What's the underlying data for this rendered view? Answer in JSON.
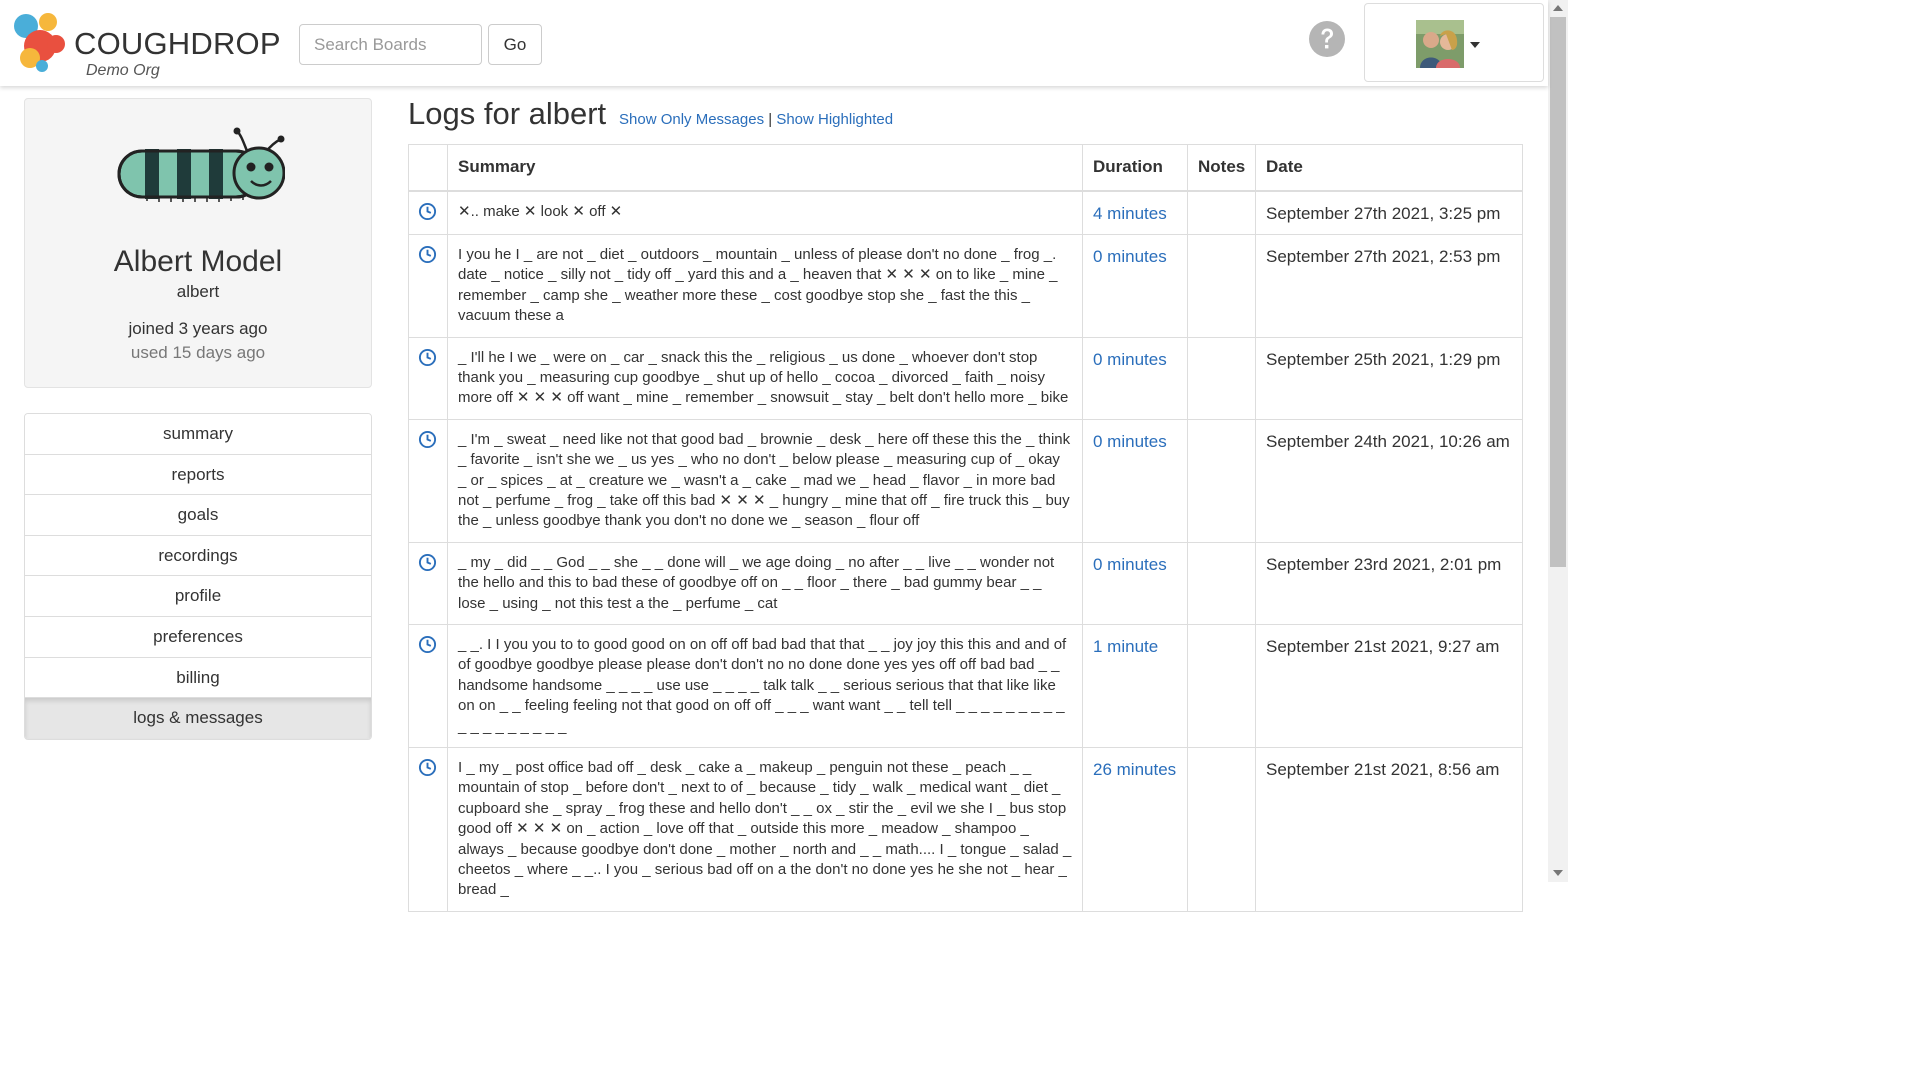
{
  "header": {
    "brand": "COUGHDROP",
    "org": "Demo Org",
    "search_placeholder": "Search Boards",
    "go_label": "Go"
  },
  "profile": {
    "name": "Albert Model",
    "username": "albert",
    "joined": "joined 3 years ago",
    "used": "used 15 days ago"
  },
  "nav": [
    {
      "label": "summary",
      "active": false
    },
    {
      "label": "reports",
      "active": false
    },
    {
      "label": "goals",
      "active": false
    },
    {
      "label": "recordings",
      "active": false
    },
    {
      "label": "profile",
      "active": false
    },
    {
      "label": "preferences",
      "active": false
    },
    {
      "label": "billing",
      "active": false
    },
    {
      "label": "logs & messages",
      "active": true
    }
  ],
  "main": {
    "title": "Logs for albert",
    "filter_messages": "Show Only Messages",
    "filter_sep": "|",
    "filter_highlighted": "Show Highlighted"
  },
  "table": {
    "headers": {
      "summary": "Summary",
      "duration": "Duration",
      "notes": "Notes",
      "date": "Date"
    },
    "rows": [
      {
        "summary": "✕.. make ✕ look ✕ off ✕",
        "duration": "4 minutes",
        "notes": "",
        "date": "September 27th 2021, 3:25 pm"
      },
      {
        "summary": "I you he I _ are not _ diet _ outdoors _ mountain _ unless of please don't no done _ frog _. date _ notice _ silly not _ tidy off _ yard this and a _ heaven that ✕ ✕ ✕ on to like _ mine _ remember _ camp she _ weather more these _ cost goodbye stop she _ fast the this _ vacuum these a",
        "duration": "0 minutes",
        "notes": "",
        "date": "September 27th 2021, 2:53 pm"
      },
      {
        "summary": "_ I'll he I we _ were on _ car _ snack this the _ religious _ us done _ whoever don't stop thank you _ measuring cup goodbye _ shut up of hello _ cocoa _ divorced _ faith _ noisy more off ✕ ✕ ✕ off want _ mine _ remember _ snowsuit _ stay _ belt don't hello more _ bike",
        "duration": "0 minutes",
        "notes": "",
        "date": "September 25th 2021, 1:29 pm"
      },
      {
        "summary": "_ I'm _ sweat _ need like not that good bad _ brownie _ desk _ here off these this the _ think _ favorite _ isn't she we _ us yes _ who no don't _ below please _ measuring cup of _ okay _ or _ spices _ at _ creature we _ wasn't a _ cake _ mad we _ head _ flavor _ in more bad not _ perfume _ frog _ take off this bad ✕ ✕ ✕ _ hungry _ mine that off _ fire truck this _ buy the _ unless goodbye thank you don't no done we _ season _ flour off",
        "duration": "0 minutes",
        "notes": "",
        "date": "September 24th 2021, 10:26 am"
      },
      {
        "summary": "_ my _ did _ _ God _ _ she _ _ done will _ we age doing _ no after _ _ live _ _ wonder not the hello and this to bad these of goodbye off on _ _ floor _ there _ bad gummy bear _ _ lose _ using _ not this test a the _ perfume _ cat",
        "duration": "0 minutes",
        "notes": "",
        "date": "September 23rd 2021, 2:01 pm"
      },
      {
        "summary": "_ _. I I you you to to good good on on off off bad bad that that _ _ joy joy this this and and of of goodbye goodbye please please don't don't no no done done yes yes off off bad bad _ _ handsome handsome _ _ _ _ use use _ _ _ _ talk talk _ _ serious serious that that like like on on _ _ feeling feeling not that good on off off _ _ _ want want _ _ tell tell _ _ _ _ _ _ _ _ _ _ _ _ _ _ _ _ _ _",
        "duration": "1 minute",
        "notes": "",
        "date": "September 21st 2021, 9:27 am"
      },
      {
        "summary": "I _ my _ post office bad off _ desk _ cake a _ makeup _ penguin not these _ peach _ _ mountain of stop _ before don't _ next to of _ because _ tidy _ walk _ medical want _ diet _ cupboard she _ spray _ frog these and hello don't _ _ ox _ stir the _ evil we she I _ bus stop good off ✕ ✕ ✕ on _ action _ love off that _ outside this more _ meadow _ shampoo _ always _ because goodbye don't done _ mother _ north and _ _ math.... I _ tongue _ salad _ cheetos _ where _ _.. I you _ serious bad off on a the don't no done yes he she not _ hear _ bread _",
        "duration": "26 minutes",
        "notes": "",
        "date": "September 21st 2021, 8:56 am"
      }
    ]
  }
}
